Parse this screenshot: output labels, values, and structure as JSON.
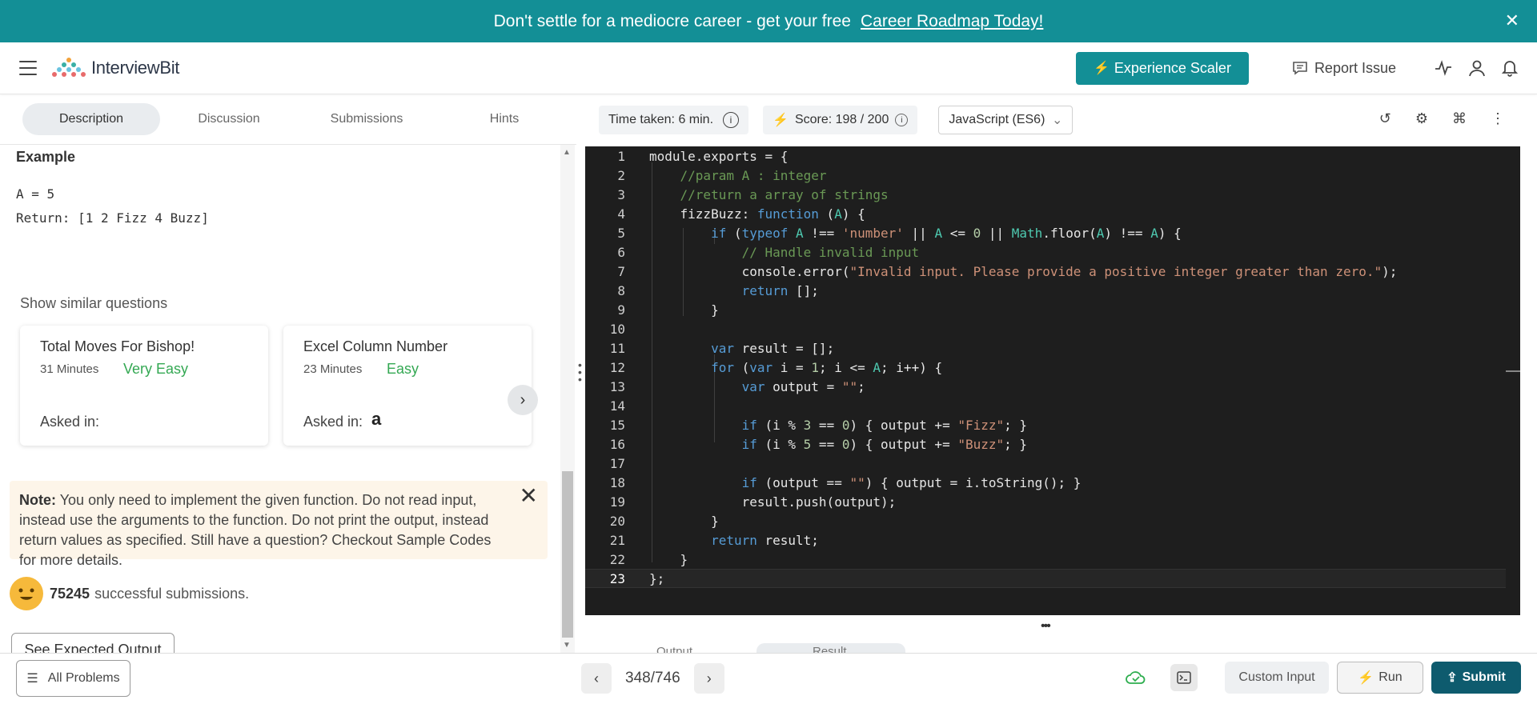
{
  "banner": {
    "text": "Don't settle for a mediocre career - get your free",
    "link": "Career Roadmap Today!",
    "close": "✕"
  },
  "header": {
    "logo_text": "InterviewBit",
    "scaler_button": "Experience Scaler",
    "report_issue": "Report Issue"
  },
  "left": {
    "tabs": [
      "Description",
      "Discussion",
      "Submissions",
      "Hints"
    ],
    "example_title": "Example",
    "example_input": "A = 5",
    "example_output": "Return: [1 2 Fizz 4 Buzz]",
    "similar_label": "Show similar questions",
    "cards": [
      {
        "title": "Total Moves For Bishop!",
        "time": "31 Minutes",
        "difficulty": "Very Easy",
        "asked": "Asked in:"
      },
      {
        "title": "Excel Column Number",
        "time": "23 Minutes",
        "difficulty": "Easy",
        "asked": "Asked in:",
        "company_glyph": "a"
      }
    ],
    "note_label": "Note:",
    "note_text": "You only need to implement the given function. Do not read input, instead use the arguments to the function. Do not print the output, instead return values as specified. Still have a question? Checkout Sample Codes for more details.",
    "success_count": "75245",
    "success_text": "successful submissions.",
    "expected_button": "See Expected Output"
  },
  "right": {
    "time_taken": "Time taken: 6 min.",
    "score": "Score: 198  /  200",
    "language": "JavaScript (ES6)",
    "bottom_tabs": [
      "Output",
      "Result"
    ]
  },
  "footer": {
    "all_problems": "All Problems",
    "page": "348/746",
    "custom_input": "Custom Input",
    "run": "Run",
    "submit": "Submit"
  }
}
